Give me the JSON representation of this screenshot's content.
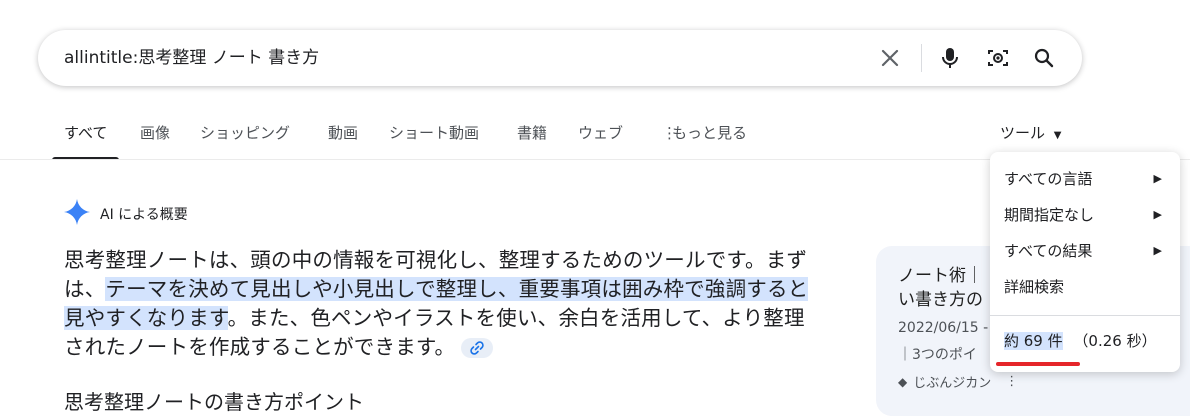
{
  "search": {
    "query": "allintitle:思考整理 ノート 書き方",
    "icons": [
      "close-icon",
      "microphone-icon",
      "camera-search-icon",
      "search-icon"
    ]
  },
  "tabs": [
    {
      "label": "すべて"
    },
    {
      "label": "画像"
    },
    {
      "label": "ショッピング"
    },
    {
      "label": "動画"
    },
    {
      "label": "ショート動画"
    },
    {
      "label": "書籍"
    },
    {
      "label": "ウェブ"
    },
    {
      "label": "もっと見る"
    }
  ],
  "tools": {
    "label": "ツール",
    "menu": [
      {
        "label": "すべての言語"
      },
      {
        "label": "期間指定なし"
      },
      {
        "label": "すべての結果"
      },
      {
        "label": "詳細検索"
      }
    ],
    "result_count": "約 69 件",
    "result_time": "（0.26 秒）"
  },
  "ai_overview": {
    "title": "AI による概要",
    "body_1": "思考整理ノートは、頭の中の情報を可視化し、整理するためのツールです。まずは、",
    "body_hl": "テーマを決めて見出しや小見出しで整理し、重要事項は囲み枠で強調すると見やすくなります",
    "body_2": "。また、色ペンやイラストを使い、余白を活用して、より整理されたノートを作成することができます。",
    "subheading": "思考整理ノートの書き方ポイント"
  },
  "card": {
    "title": "ノート術｜\nい書き方の",
    "date": "2022/06/15 -",
    "snippet": "｜3つのポイ",
    "source": "じぶんジカン"
  },
  "colors": {
    "highlight": "#d3e3fd",
    "underline": "#e5252a"
  }
}
